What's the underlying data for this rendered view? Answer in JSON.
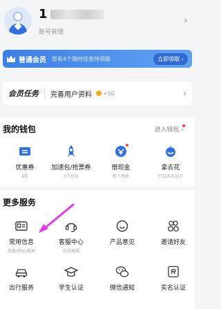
{
  "profile": {
    "username_visible": "1",
    "account_manage": "账号管理",
    "chevron": "›"
  },
  "member_bar": {
    "icon": "crown-icon",
    "label": "普通会员",
    "desc": "您有4个限时任务待领取",
    "action": "立即领取 ›"
  },
  "task_card": {
    "logo": "会员任务",
    "name": "完善用户资料",
    "points": "+50",
    "chevron": "›"
  },
  "wallet": {
    "title": "我的钱包",
    "enter": "进入钱包 ›",
    "items": [
      {
        "icon": "ticket-icon",
        "label": "优惠券",
        "sub": "4张"
      },
      {
        "icon": "rocket-icon",
        "label": "加速包/抢票券",
        "sub": "0个/0张"
      },
      {
        "icon": "cash-icon",
        "label": "借现金",
        "sub": "新人免息"
      },
      {
        "icon": "flower-icon",
        "label": "拿去花",
        "sub": "打白条去远方"
      }
    ]
  },
  "services": {
    "title": "更多服务",
    "items": [
      {
        "icon": "id-card-icon",
        "label": "常用信息",
        "sub": "旅客/地址/报销"
      },
      {
        "icon": "headset-icon",
        "label": "客服中心",
        "sub": "在线客服"
      },
      {
        "icon": "smile-icon",
        "label": "产品意见",
        "sub": ""
      },
      {
        "icon": "friends-icon",
        "label": "邀请好友",
        "sub": ""
      },
      {
        "icon": "car-icon",
        "label": "出行服务",
        "sub": ""
      },
      {
        "icon": "graduation-cap-icon",
        "label": "学生认证",
        "sub": ""
      },
      {
        "icon": "wechat-icon",
        "label": "微信通知",
        "sub": ""
      },
      {
        "icon": "realname-icon",
        "label": "实名认证",
        "sub": ""
      }
    ]
  },
  "colors": {
    "brand_blue": "#3c7fe6",
    "annotation_arrow": "#e13be8"
  }
}
